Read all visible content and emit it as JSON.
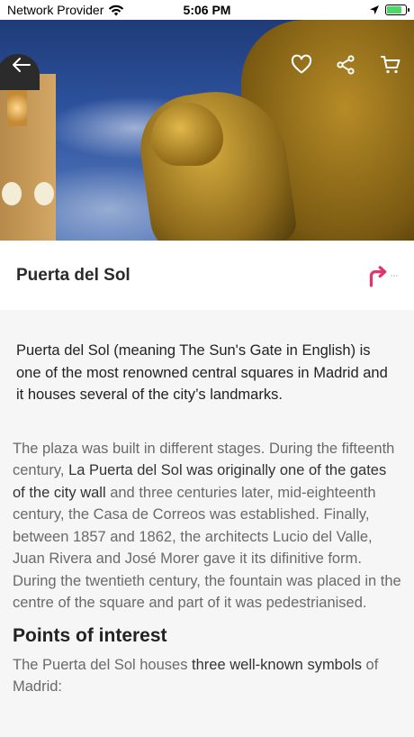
{
  "status_bar": {
    "carrier": "Network Provider",
    "time": "5:06 PM"
  },
  "hero": {
    "image_subject": "Bear and strawberry tree statue, Puerta del Sol"
  },
  "header_actions": {
    "icons": [
      "back-arrow-icon",
      "heart-icon",
      "share-icon",
      "cart-icon"
    ]
  },
  "place": {
    "title": "Puerta del Sol"
  },
  "intro": "Puerta del Sol (meaning The Sun's Gate in English) is one of the most renowned central squares in Madrid and it houses several of the city’s landmarks.",
  "history": {
    "part1": "The plaza was built in different stages. During the fifteenth century, ",
    "highlight": "La Puerta del Sol was originally one of the gates of the city wall",
    "part2": " and three centuries later, mid-eighteenth century, the Casa de Correos was established. Finally, between 1857 and 1862, the architects Lucio del Valle, Juan Rivera and José Morer gave it its difinitive form. During the twentieth century, the fountain was placed in the centre of the square and part of it was pedestrianised."
  },
  "points_of_interest": {
    "heading": "Points of interest",
    "part1": "The Puerta del Sol houses ",
    "highlight": "three well-known symbols",
    "part2": " of Madrid:"
  },
  "colors": {
    "accent": "#e2336a",
    "battery": "#4cd964"
  }
}
